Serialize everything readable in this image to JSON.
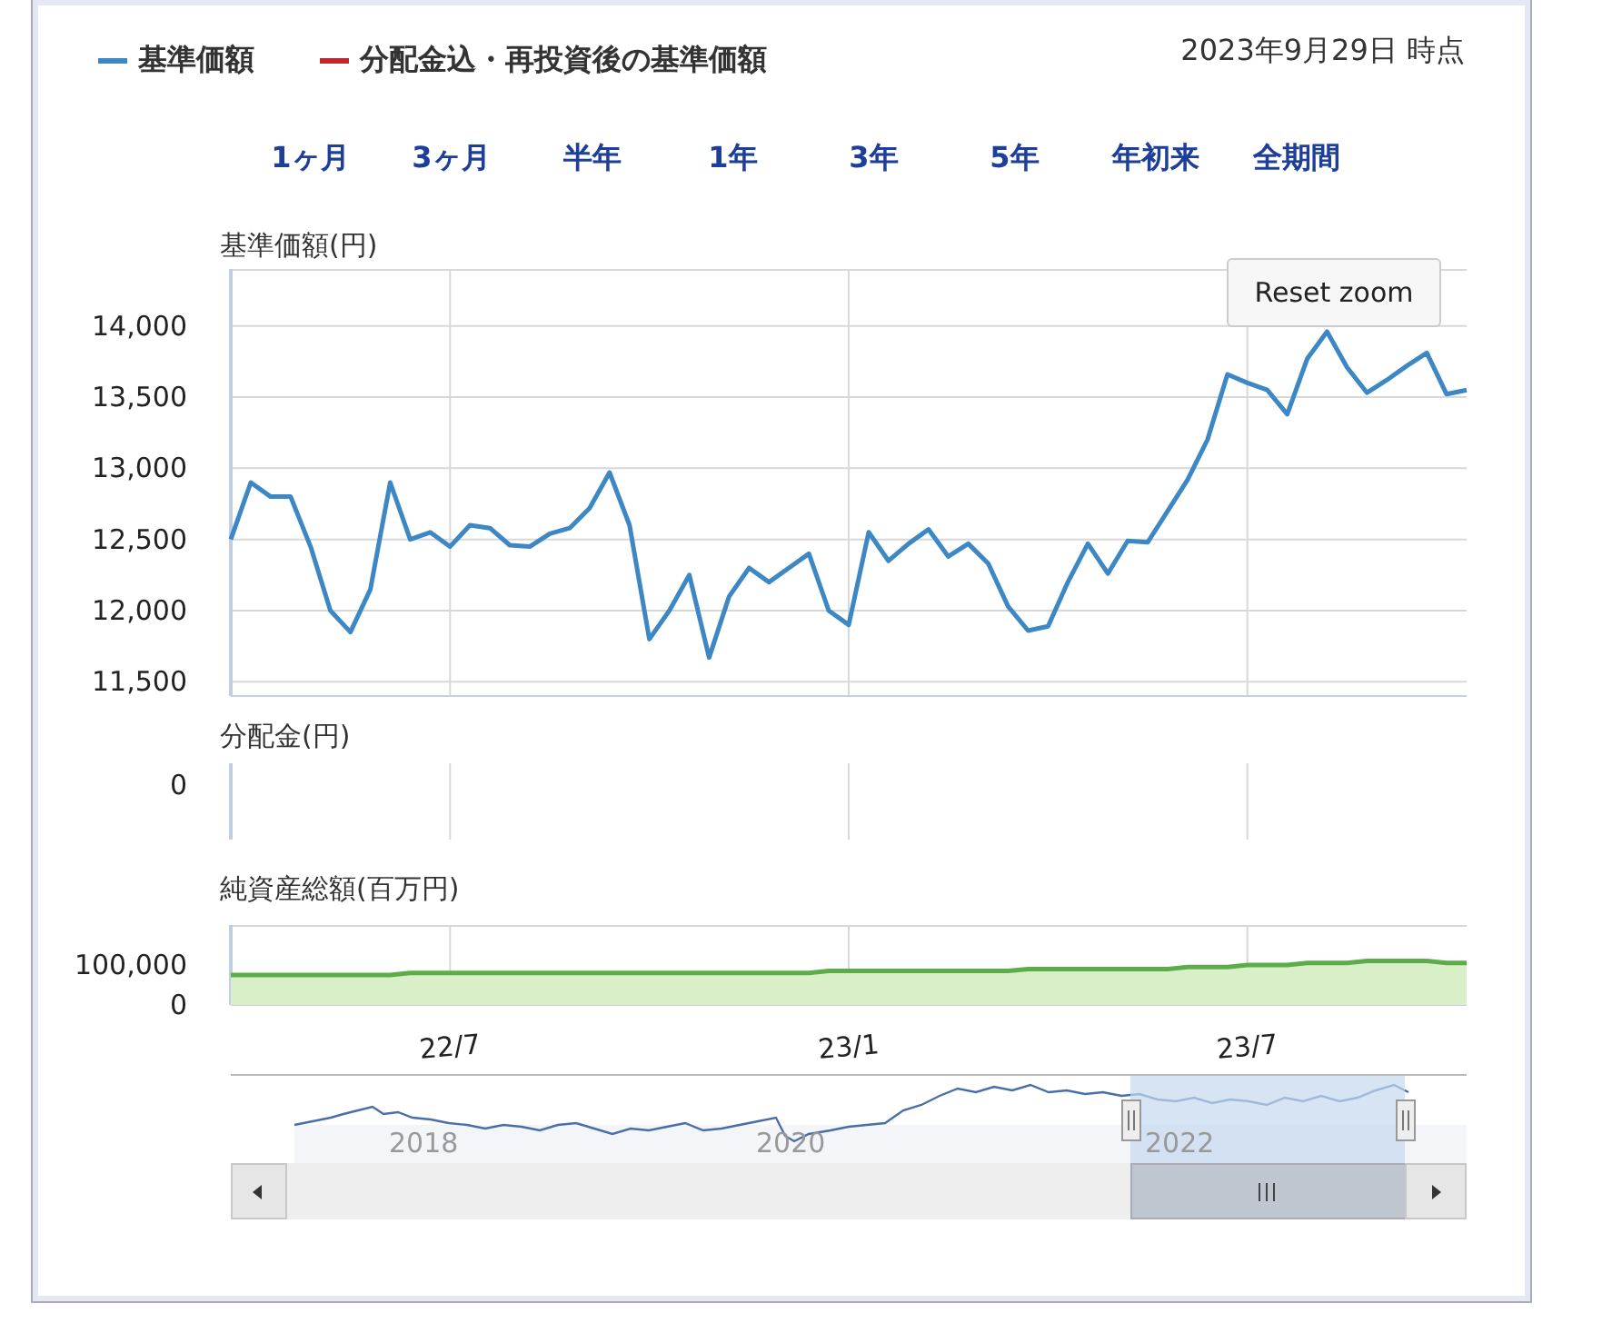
{
  "legend": [
    {
      "label": "基準価額",
      "color": "#3c87c4"
    },
    {
      "label": "分配金込・再投資後の基準価額",
      "color": "#c0282d"
    }
  ],
  "as_of": "2023年9月29日 時点",
  "ranges": [
    {
      "label": "1ヶ月",
      "selected": false
    },
    {
      "label": "3ヶ月",
      "selected": false
    },
    {
      "label": "半年",
      "selected": false
    },
    {
      "label": "1年",
      "selected": false
    },
    {
      "label": "3年",
      "selected": false
    },
    {
      "label": "5年",
      "selected": false
    },
    {
      "label": "年初来",
      "selected": false
    },
    {
      "label": "全期間",
      "selected": false
    }
  ],
  "reset_zoom": "Reset zoom",
  "price_chart": {
    "chart_data": {
      "type": "line",
      "ylabel": "基準価額(円)",
      "grid": true,
      "ylim": [
        11400,
        14400
      ],
      "yticks": [
        {
          "value": 11500,
          "label": "11,500"
        },
        {
          "value": 12000,
          "label": "12,000"
        },
        {
          "value": 12500,
          "label": "12,500"
        },
        {
          "value": 13000,
          "label": "13,000"
        },
        {
          "value": 13500,
          "label": "13,500"
        },
        {
          "value": 14000,
          "label": "14,000"
        }
      ],
      "categories": [
        null,
        null,
        null,
        null,
        null,
        null,
        null,
        null,
        null,
        null,
        null,
        null,
        null,
        null,
        null,
        null,
        null,
        null,
        null,
        null,
        null,
        null,
        null,
        null,
        null,
        null,
        null,
        null,
        null,
        null,
        null,
        null,
        null,
        null,
        null,
        null,
        null,
        null,
        null,
        null,
        null,
        null,
        null,
        null,
        null,
        null,
        null,
        null,
        null,
        null,
        null,
        null,
        null,
        null,
        null,
        null,
        null,
        null,
        null,
        null,
        null,
        null,
        null
      ],
      "series": [
        {
          "color": "#3c87c4",
          "values": [
            12500,
            12900,
            12800,
            12800,
            12450,
            12000,
            11850,
            12150,
            12900,
            12500,
            12550,
            12450,
            12600,
            12580,
            12460,
            12450,
            12540,
            12580,
            12720,
            12970,
            12600,
            11800,
            12000,
            12250,
            11670,
            12100,
            12300,
            12200,
            12300,
            12400,
            12000,
            11900,
            12550,
            12350,
            12470,
            12570,
            12380,
            12470,
            12330,
            12030,
            11860,
            11890,
            12200,
            12470,
            12260,
            12490,
            12480,
            12700,
            12920,
            13200,
            13660,
            13600,
            13550,
            13380,
            13770,
            13960,
            13710,
            13530,
            13620,
            13720,
            13810,
            13520,
            13550
          ]
        }
      ]
    }
  },
  "distribution": {
    "title": "分配金(円)",
    "ytick": "0"
  },
  "assets_chart": {
    "chart_data": {
      "type": "area",
      "ylabel": "純資産総額(百万円)",
      "grid": true,
      "ylim": [
        0,
        200000
      ],
      "yticks": [
        {
          "value": 0,
          "label": "0"
        },
        {
          "value": 100000,
          "label": "100,000"
        }
      ],
      "categories": [
        null,
        null,
        null,
        null,
        null,
        null,
        null,
        null,
        null,
        null,
        null,
        "22/7",
        null,
        null,
        null,
        null,
        null,
        null,
        null,
        null,
        null,
        null,
        null,
        null,
        null,
        null,
        null,
        null,
        null,
        null,
        null,
        "23/1",
        null,
        null,
        null,
        null,
        null,
        null,
        null,
        null,
        null,
        null,
        null,
        null,
        null,
        null,
        null,
        null,
        null,
        null,
        null,
        "23/7",
        null,
        null,
        null,
        null,
        null,
        null,
        null,
        null,
        null,
        null,
        null
      ],
      "series": [
        {
          "color": "#5cad4a",
          "values": [
            75000,
            75000,
            75000,
            75000,
            75000,
            75000,
            75000,
            75000,
            75000,
            80000,
            80000,
            80000,
            80000,
            80000,
            80000,
            80000,
            80000,
            80000,
            80000,
            80000,
            80000,
            80000,
            80000,
            80000,
            80000,
            80000,
            80000,
            80000,
            80000,
            80000,
            85000,
            85000,
            85000,
            85000,
            85000,
            85000,
            85000,
            85000,
            85000,
            85000,
            90000,
            90000,
            90000,
            90000,
            90000,
            90000,
            90000,
            90000,
            95000,
            95000,
            95000,
            100000,
            100000,
            100000,
            105000,
            105000,
            105000,
            110000,
            110000,
            110000,
            110000,
            105000,
            105000
          ]
        }
      ]
    }
  },
  "navigator": {
    "years": [
      "2018",
      "2020",
      "2022"
    ]
  }
}
